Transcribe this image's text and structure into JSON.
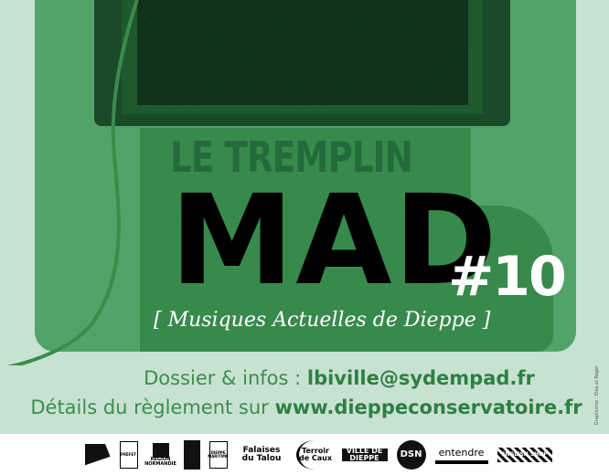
{
  "poster": {
    "kicker": "LE TREMPLIN",
    "title": "MAD",
    "edition": "#10",
    "subtitle": "[ Musiques Actuelles de Dieppe ]"
  },
  "contact": {
    "dossier_label": "Dossier & infos : ",
    "email": "lbiville@sydempad.fr",
    "details_label": "Détails du règlement sur ",
    "website": "www.dieppeconservatoire.fr"
  },
  "credit": "Graphisme : Elsa et Roger",
  "colors": {
    "background": "#c8e2d1",
    "panel": "#52a36a",
    "panel_dark": "#378a4c",
    "amp": "#1a4a27",
    "text_green": "#3b8c50"
  },
  "partners": [
    {
      "name": "logo-1",
      "text": ""
    },
    {
      "name": "prefet",
      "text": "PRÉFET"
    },
    {
      "name": "region-normandie",
      "text": "RÉGION NORMANDIE"
    },
    {
      "name": "seine-maritime-dept",
      "text": ""
    },
    {
      "name": "dieppe-maritime",
      "text": "DIEPPE MARITIME"
    },
    {
      "name": "falaises-du-talou",
      "text": "Falaises du Talou"
    },
    {
      "name": "terroir-de-caux",
      "text": "Terroir de Caux"
    },
    {
      "name": "ville-de-dieppe",
      "text": "VILLE DE DIEPPE"
    },
    {
      "name": "dieppe-scene-nationale",
      "text": "DSN"
    },
    {
      "name": "entendre",
      "text": "entendre"
    },
    {
      "name": "english-shop",
      "text": "ENGLISH SHOP"
    }
  ]
}
